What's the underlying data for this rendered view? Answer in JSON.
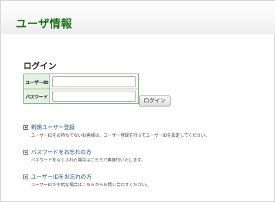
{
  "page": {
    "title": "ユーザ情報"
  },
  "login": {
    "heading": "ログイン",
    "userid_label": "ユーザーID",
    "userid_value": "",
    "password_label": "パスワード",
    "password_value": "",
    "button_label": "ログイン"
  },
  "links": [
    {
      "title": "新規ユーザー登録",
      "description": "ユーザーIDをお持ちでないお客様は、ユーザー登録を行ってユーザーIDを設定してください。"
    },
    {
      "title": "パスワードをお忘れの方",
      "description": "パスワードをなくされた場合はこちらで再発行いたします。"
    },
    {
      "title": "ユーザーIDをお忘れの方",
      "description": "ユーザーIDが不明な場合はこちらからお問い合わせください。"
    }
  ],
  "icons": {
    "link_icon": "arrow-bullet-icon"
  },
  "colors": {
    "title": "#1b6e1b",
    "link": "#1f4f86",
    "label_bg": "#e3f1e3",
    "table_border": "#7fb07f"
  }
}
